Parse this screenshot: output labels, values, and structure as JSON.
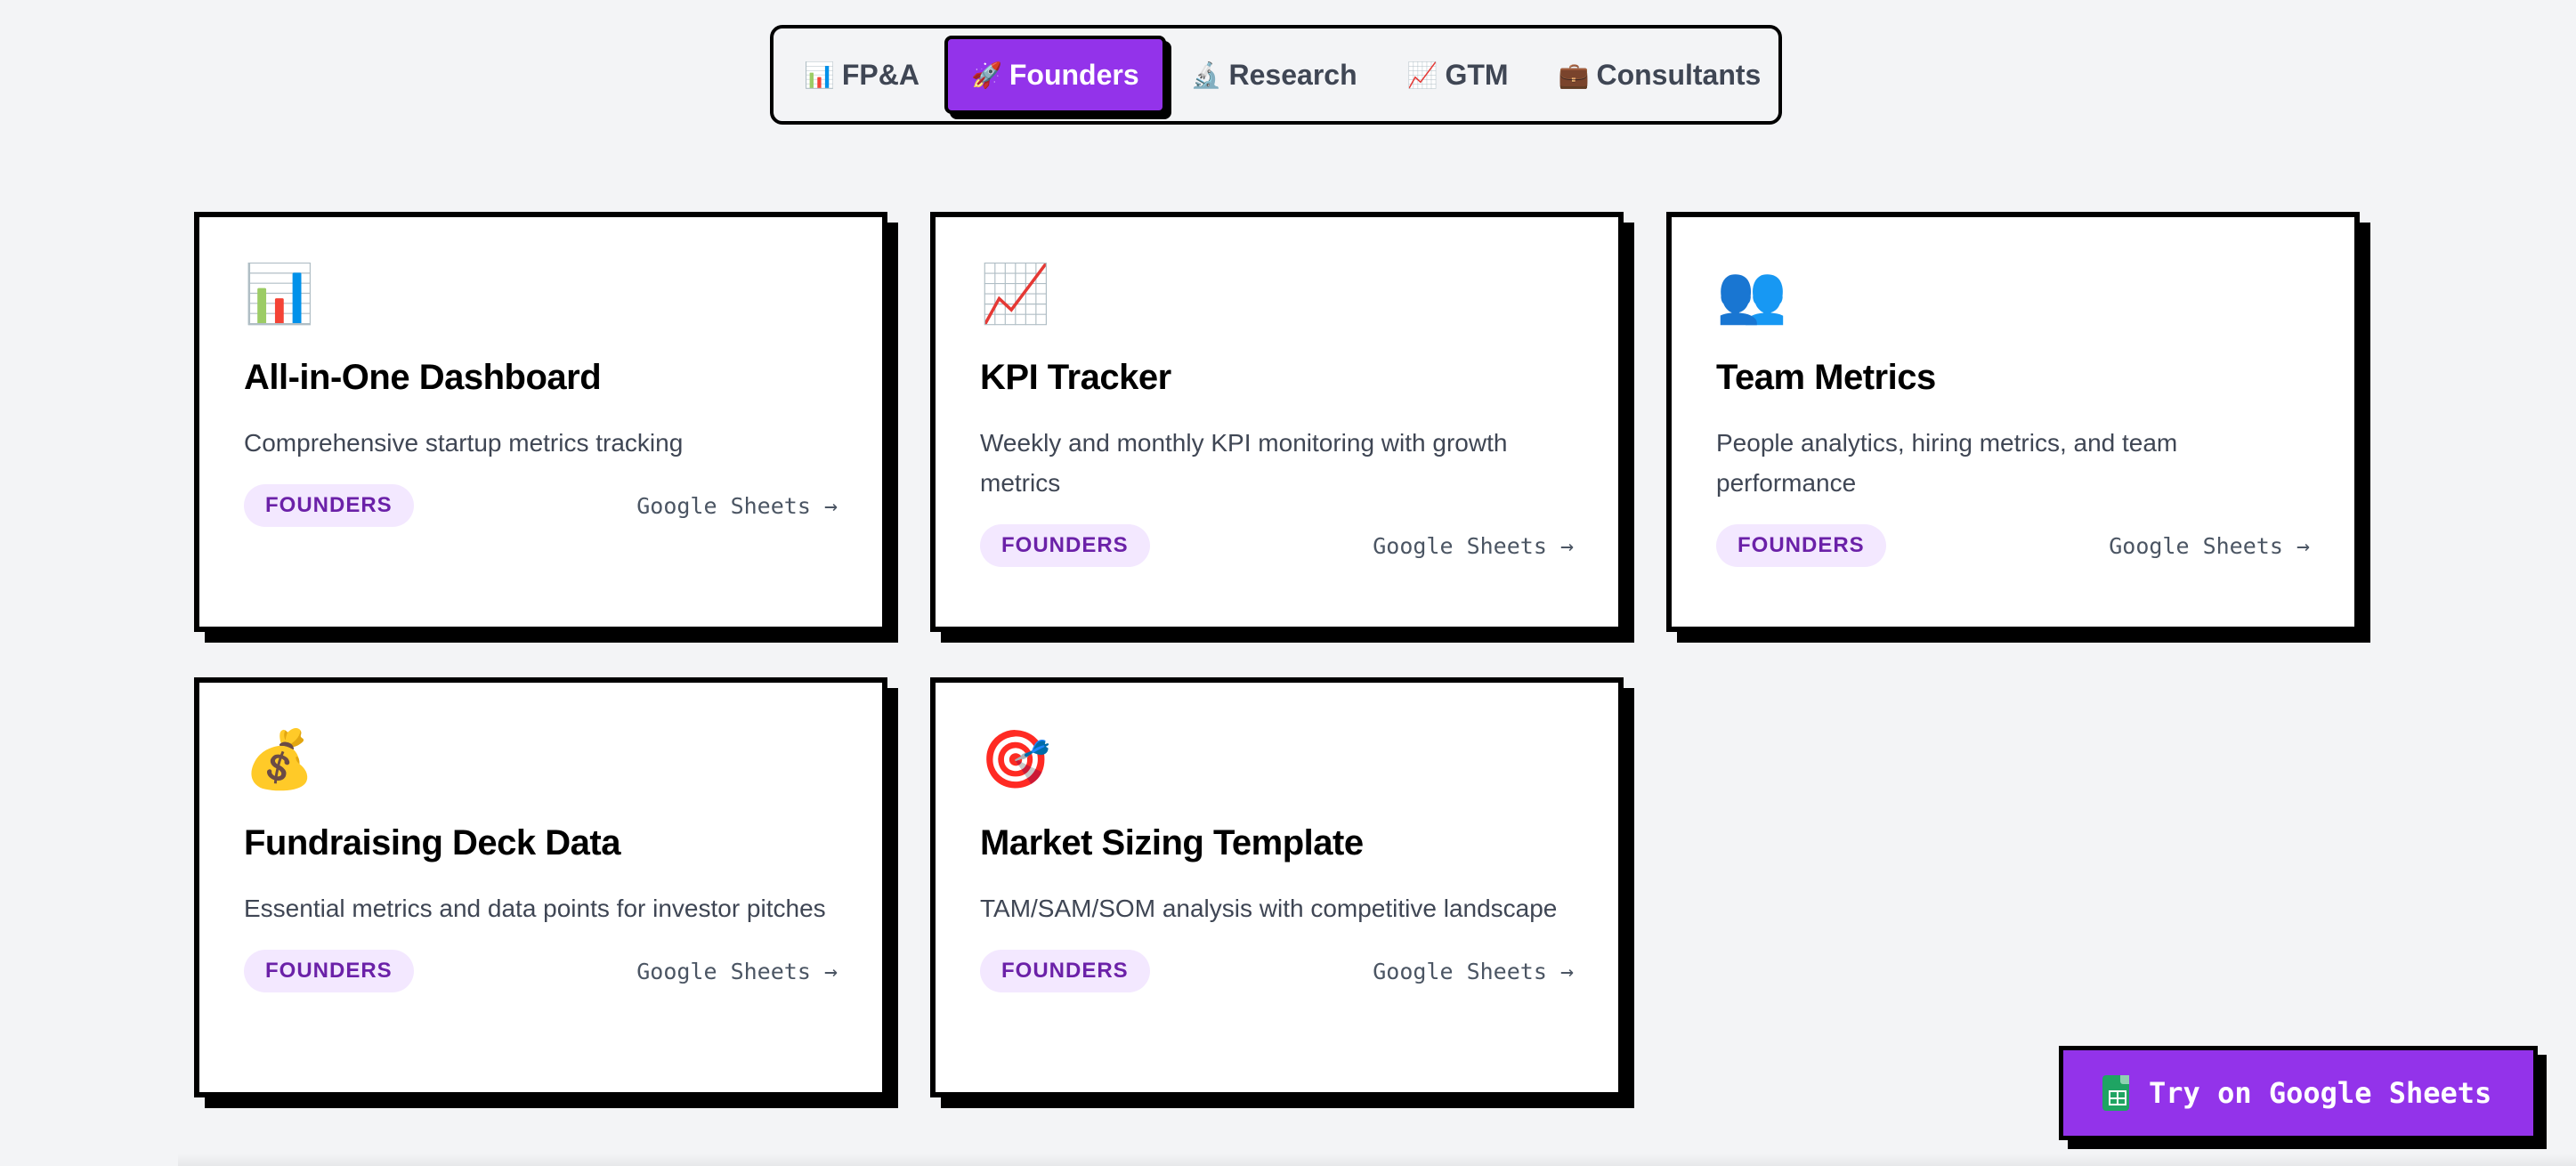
{
  "tabs": [
    {
      "icon": "📊",
      "icon_name": "bar-chart-icon",
      "label": "FP&A",
      "active": false
    },
    {
      "icon": "🚀",
      "icon_name": "rocket-icon",
      "label": "Founders",
      "active": true
    },
    {
      "icon": "🔬",
      "icon_name": "microscope-icon",
      "label": "Research",
      "active": false
    },
    {
      "icon": "📈",
      "icon_name": "trending-up-icon",
      "label": "GTM",
      "active": false
    },
    {
      "icon": "💼",
      "icon_name": "briefcase-icon",
      "label": "Consultants",
      "active": false
    }
  ],
  "cards": [
    {
      "icon": "📊",
      "icon_name": "bar-chart-icon",
      "title": "All-in-One Dashboard",
      "description": "Comprehensive startup metrics tracking",
      "badge": "FOUNDERS",
      "link": "Google Sheets →"
    },
    {
      "icon": "📈",
      "icon_name": "trending-up-icon",
      "title": "KPI Tracker",
      "description": "Weekly and monthly KPI monitoring with growth metrics",
      "badge": "FOUNDERS",
      "link": "Google Sheets →"
    },
    {
      "icon": "👥",
      "icon_name": "people-icon",
      "title": "Team Metrics",
      "description": "People analytics, hiring metrics, and team performance",
      "badge": "FOUNDERS",
      "link": "Google Sheets →"
    },
    {
      "icon": "💰",
      "icon_name": "money-bag-icon",
      "title": "Fundraising Deck Data",
      "description": "Essential metrics and data points for investor pitches",
      "badge": "FOUNDERS",
      "link": "Google Sheets →"
    },
    {
      "icon": "🎯",
      "icon_name": "target-icon",
      "title": "Market Sizing Template",
      "description": "TAM/SAM/SOM analysis with competitive landscape",
      "badge": "FOUNDERS",
      "link": "Google Sheets →"
    }
  ],
  "cta": {
    "label": "Try on Google Sheets",
    "icon_name": "google-sheets-icon"
  },
  "colors": {
    "accent": "#9333ea",
    "badge_bg": "#f3e8ff",
    "badge_text": "#6b21a8",
    "page_bg": "#f3f4f6"
  }
}
